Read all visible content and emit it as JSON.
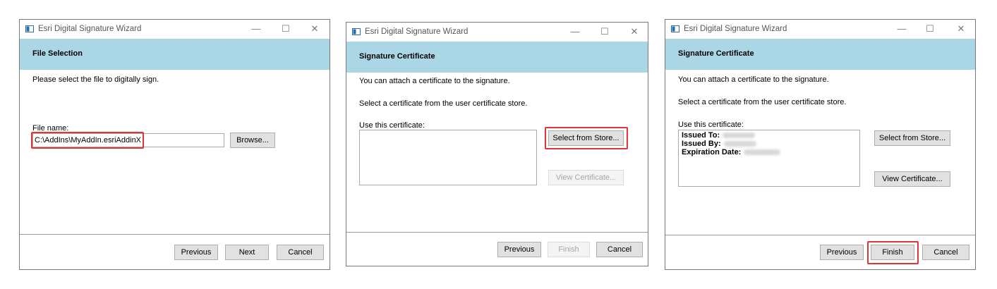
{
  "dialogs": [
    {
      "title": "Esri Digital Signature Wizard",
      "header": "File Selection",
      "instructions": "Please select the file to digitally sign.",
      "file_label": "File name:",
      "file_value": "C:\\AddIns\\MyAddIn.esriAddinX",
      "browse_label": "Browse...",
      "previous_label": "Previous",
      "next_label": "Next",
      "cancel_label": "Cancel"
    },
    {
      "title": "Esri Digital Signature Wizard",
      "header": "Signature Certificate",
      "line1": "You can attach a certificate to the signature.",
      "line2": "Select a certificate from the user certificate store.",
      "cert_label": "Use this certificate:",
      "select_store_label": "Select from Store...",
      "view_cert_label": "View Certificate...",
      "previous_label": "Previous",
      "finish_label": "Finish",
      "cancel_label": "Cancel"
    },
    {
      "title": "Esri Digital Signature Wizard",
      "header": "Signature Certificate",
      "line1": "You can attach a certificate to the signature.",
      "line2": "Select a certificate from the user certificate store.",
      "cert_label": "Use this certificate:",
      "issued_to_label": "Issued To:",
      "issued_by_label": "Issued By:",
      "expiration_label": "Expiration Date:",
      "select_store_label": "Select from Store...",
      "view_cert_label": "View Certificate...",
      "previous_label": "Previous",
      "finish_label": "Finish",
      "cancel_label": "Cancel"
    }
  ],
  "window_controls": {
    "minimize": "—",
    "maximize": "☐",
    "close": "✕"
  },
  "colors": {
    "header_band": "#abd6e5",
    "highlight": "#e0363a"
  }
}
